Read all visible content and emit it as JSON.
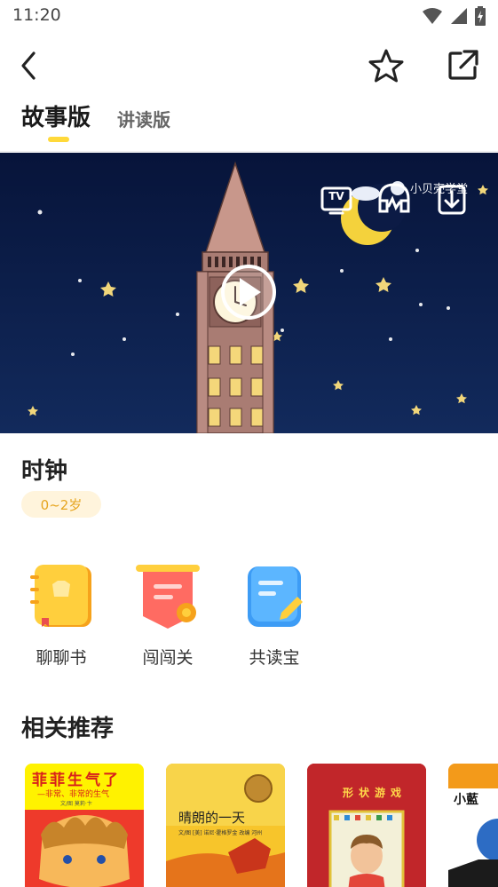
{
  "status": {
    "time": "11:20"
  },
  "tabs": {
    "story": "故事版",
    "reading": "讲读版"
  },
  "video": {
    "watermark": "小贝壳学堂",
    "tv_label": "TV",
    "icons": [
      "tv-icon",
      "audio-headphones-icon",
      "download-icon",
      "play-icon"
    ]
  },
  "book": {
    "title": "时钟",
    "age": "0~2岁"
  },
  "features": [
    {
      "label": "聊聊书",
      "icon": "notebook-icon"
    },
    {
      "label": "闯闯关",
      "icon": "badge-flag-icon"
    },
    {
      "label": "共读宝",
      "icon": "note-pencil-icon"
    }
  ],
  "recommend": {
    "title": "相关推荐",
    "books": [
      {
        "title": "菲菲生气了",
        "subtitle": "—非常、非常的生气",
        "meta": "文/图 莫莉·卞"
      },
      {
        "title": "晴朗的一天",
        "meta": "文/图 [美] 诺尼·霍格罗金 改编 河州"
      },
      {
        "title": "形状游戏"
      },
      {
        "title": "小藍"
      }
    ]
  },
  "colors": {
    "accent": "#ffd93a",
    "age_text": "#e6a51f",
    "age_bg": "#fff4dc",
    "night_sky": "#0c1b45"
  }
}
